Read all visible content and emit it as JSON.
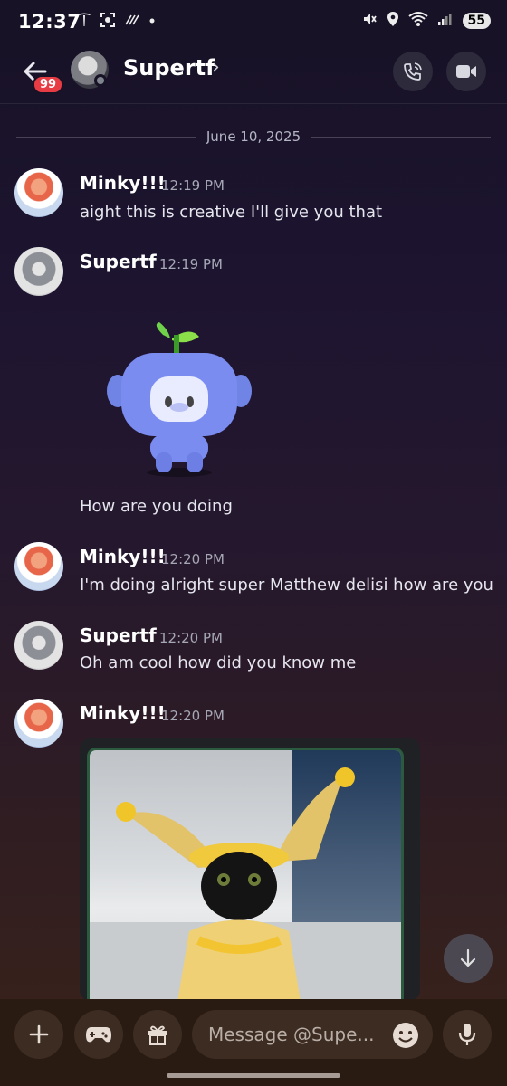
{
  "status": {
    "time": "12:37",
    "battery": "55",
    "network": "5"
  },
  "header": {
    "unread_badge": "99",
    "name": "Supertf",
    "chevron": "›"
  },
  "date_separator": "June 10, 2025",
  "messages": [
    {
      "author": "Minky!!!",
      "time": "12:19 PM",
      "text": "aight this is creative I'll give you that"
    },
    {
      "author": "Supertf",
      "time": "12:19 PM",
      "text": "How are you doing"
    },
    {
      "author": "Minky!!!",
      "time": "12:20 PM",
      "text": "I'm doing alright super Matthew delisi how are you"
    },
    {
      "author": "Supertf",
      "time": "12:20 PM",
      "text": "Oh am cool how did you know me"
    },
    {
      "author": "Minky!!!",
      "time": "12:20 PM",
      "text": ""
    }
  ],
  "composer": {
    "placeholder": "Message @Supe..."
  },
  "colors": {
    "badge": "#e83c45",
    "composer_bg": "#2a1b12",
    "wumpus": "#7b8cf0"
  }
}
